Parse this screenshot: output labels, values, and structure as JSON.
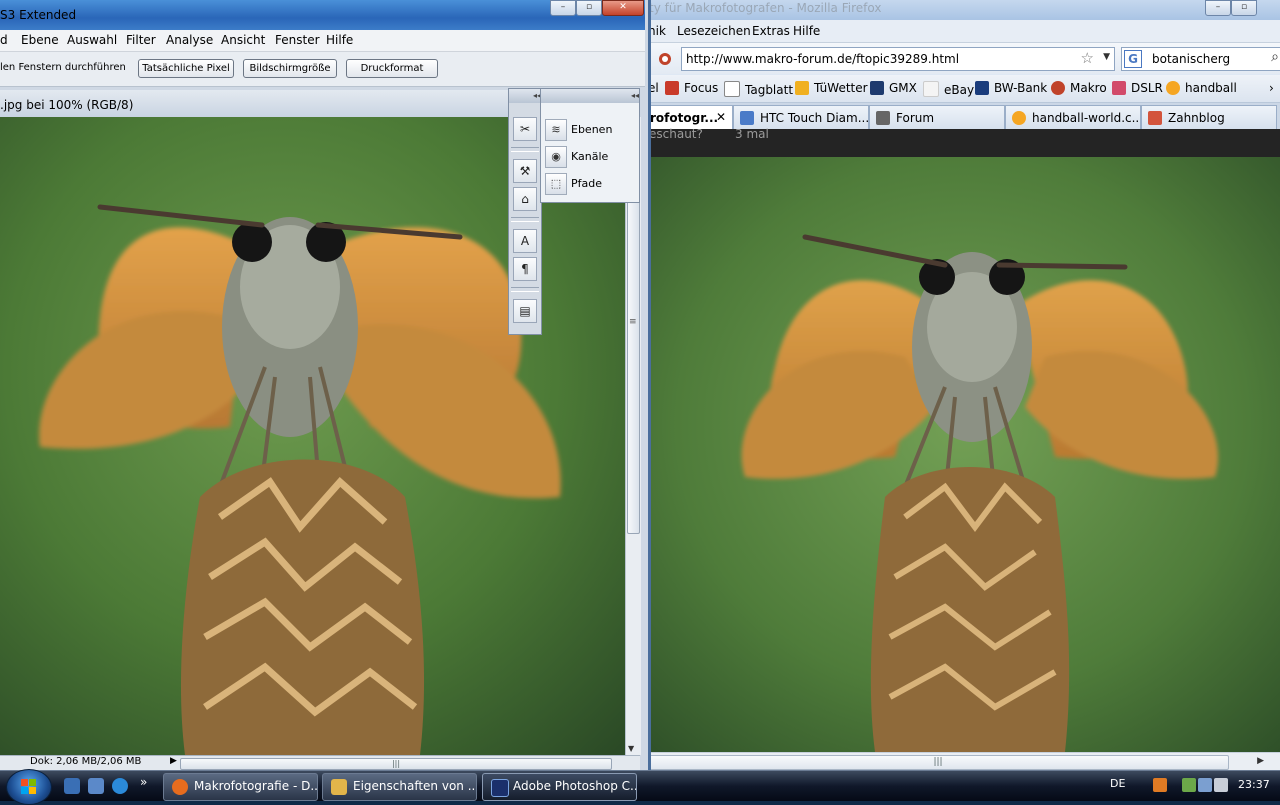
{
  "firefox": {
    "title": "ty für Makrofotografen - Mozilla Firefox",
    "menu": [
      "nik",
      "Lesezeichen",
      "Extras",
      "Hilfe"
    ],
    "url": "http://www.makro-forum.de/ftopic39289.html",
    "search_value": "botanischerg",
    "bookmarks": [
      "el",
      "Focus",
      "Tagblatt",
      "TüWetter",
      "GMX",
      "eBay",
      "BW-Bank",
      "Makro",
      "DSLR",
      "handball"
    ],
    "tabs": [
      "rofotogr...",
      "HTC Touch Diam...",
      "Forum",
      "handball-world.c...",
      "Zahnblog"
    ],
    "page_strip": [
      "eschaut?",
      "3 mal"
    ],
    "colors": {
      "accent": "#c0432a"
    }
  },
  "photoshop": {
    "title": "S3 Extended",
    "menu": [
      "d",
      "Ebene",
      "Auswahl",
      "Filter",
      "Analyse",
      "Ansicht",
      "Fenster",
      "Hilfe"
    ],
    "options_text": "len Fenstern durchführen",
    "buttons": [
      "Tatsächliche Pixel",
      "Bildschirmgröße",
      "Druckformat"
    ],
    "doc_title": ".jpg bei 100% (RGB/8)",
    "status": "Dok: 2,06 MB/2,06 MB",
    "panel_items": [
      {
        "label": "Ebenen",
        "icon": "layers-icon"
      },
      {
        "label": "Kanäle",
        "icon": "channels-icon"
      },
      {
        "label": "Pfade",
        "icon": "paths-icon"
      }
    ],
    "tool_icons": [
      "tools-icon",
      "brush-icon",
      "stamp-icon",
      "character-icon",
      "paragraph-icon",
      "notes-icon"
    ]
  },
  "taskbar": {
    "buttons": [
      "Makrofotografie - D...",
      "Eigenschaften von ...",
      "Adobe Photoshop C..."
    ],
    "lang": "DE",
    "clock": "23:37"
  }
}
